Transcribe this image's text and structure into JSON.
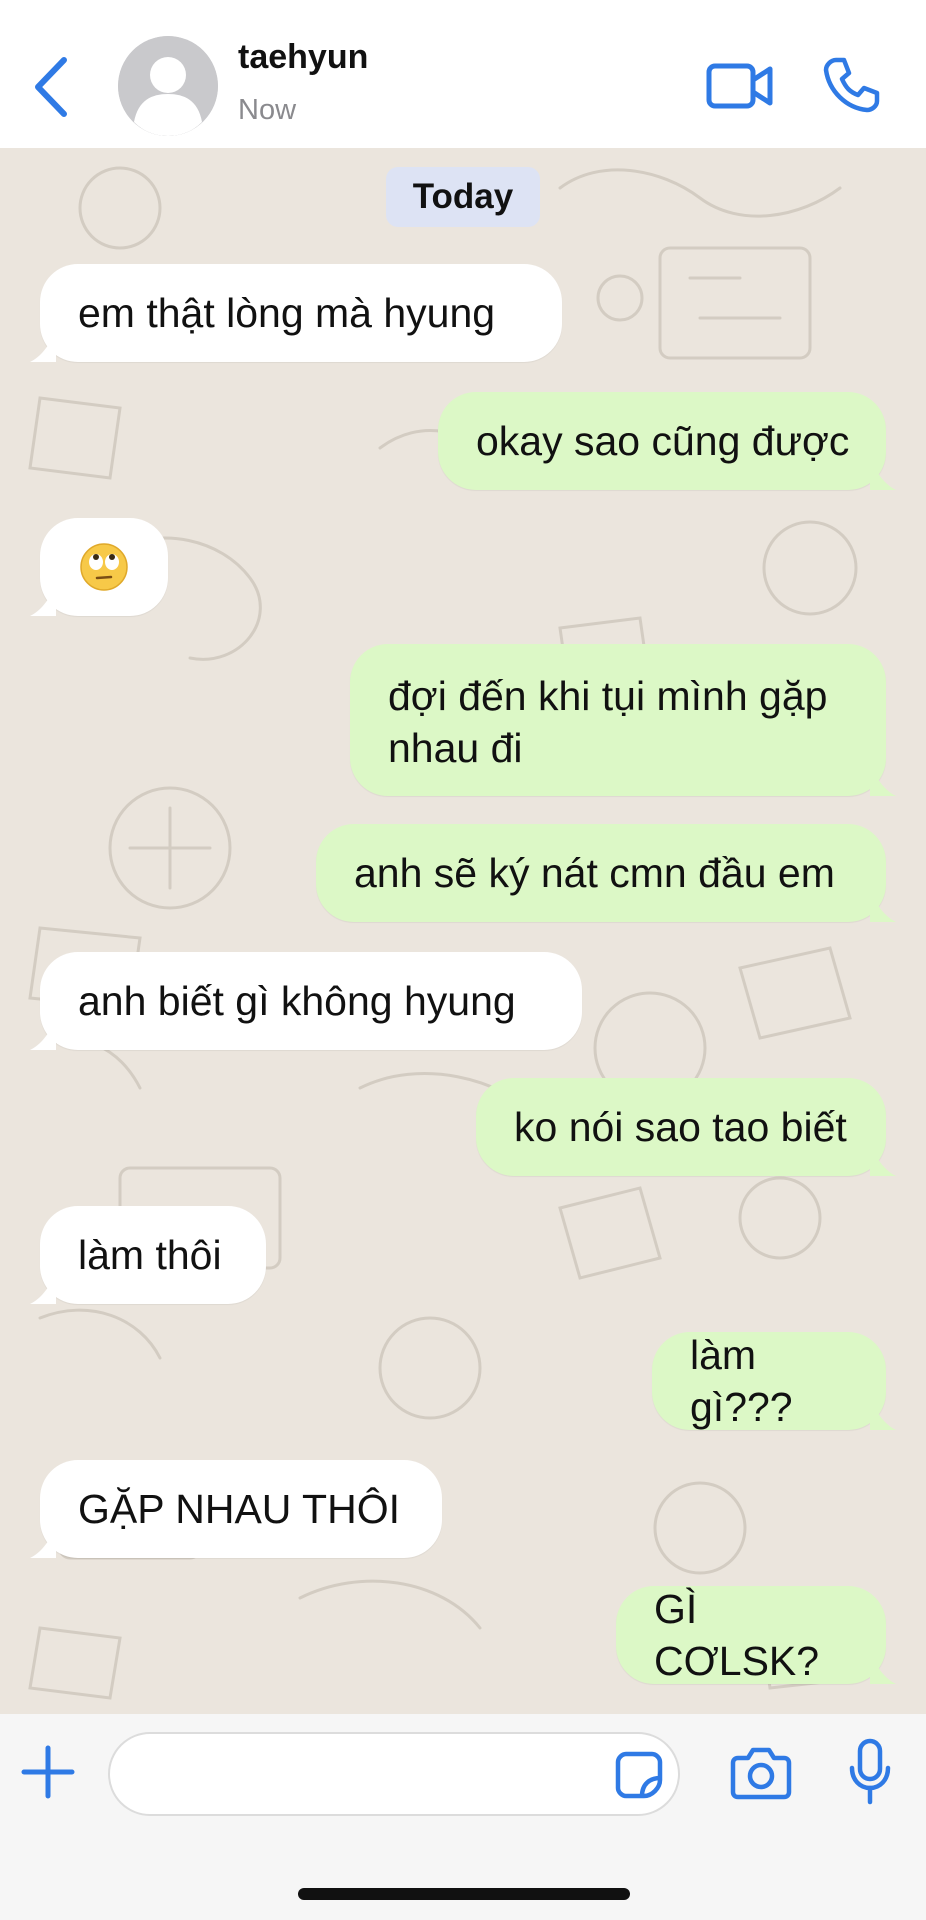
{
  "header": {
    "contact_name": "taehyun",
    "status": "Now",
    "accent_color": "#2f7ae5"
  },
  "chat": {
    "date_label": "Today",
    "wallpaper_color": "#ebe5dd",
    "incoming_bubble_color": "#ffffff",
    "outgoing_bubble_color": "#dcf8c6"
  },
  "messages": [
    {
      "direction": "in",
      "text": "em thật lòng mà hyung"
    },
    {
      "direction": "out",
      "text": "okay sao cũng được"
    },
    {
      "direction": "in",
      "text": "",
      "emoji": "face-with-rolling-eyes-icon"
    },
    {
      "direction": "out",
      "text": "đợi đến khi tụi mình gặp nhau đi"
    },
    {
      "direction": "out",
      "text": "anh sẽ ký nát cmn đầu em"
    },
    {
      "direction": "in",
      "text": "anh biết gì không hyung"
    },
    {
      "direction": "out",
      "text": "ko nói sao tao biết"
    },
    {
      "direction": "in",
      "text": "làm thôi"
    },
    {
      "direction": "out",
      "text": "làm gì???"
    },
    {
      "direction": "in",
      "text": "GẶP NHAU THÔI"
    },
    {
      "direction": "out",
      "text": "GÌ CƠLSK?"
    }
  ],
  "composer": {
    "input_value": "",
    "input_placeholder": ""
  }
}
